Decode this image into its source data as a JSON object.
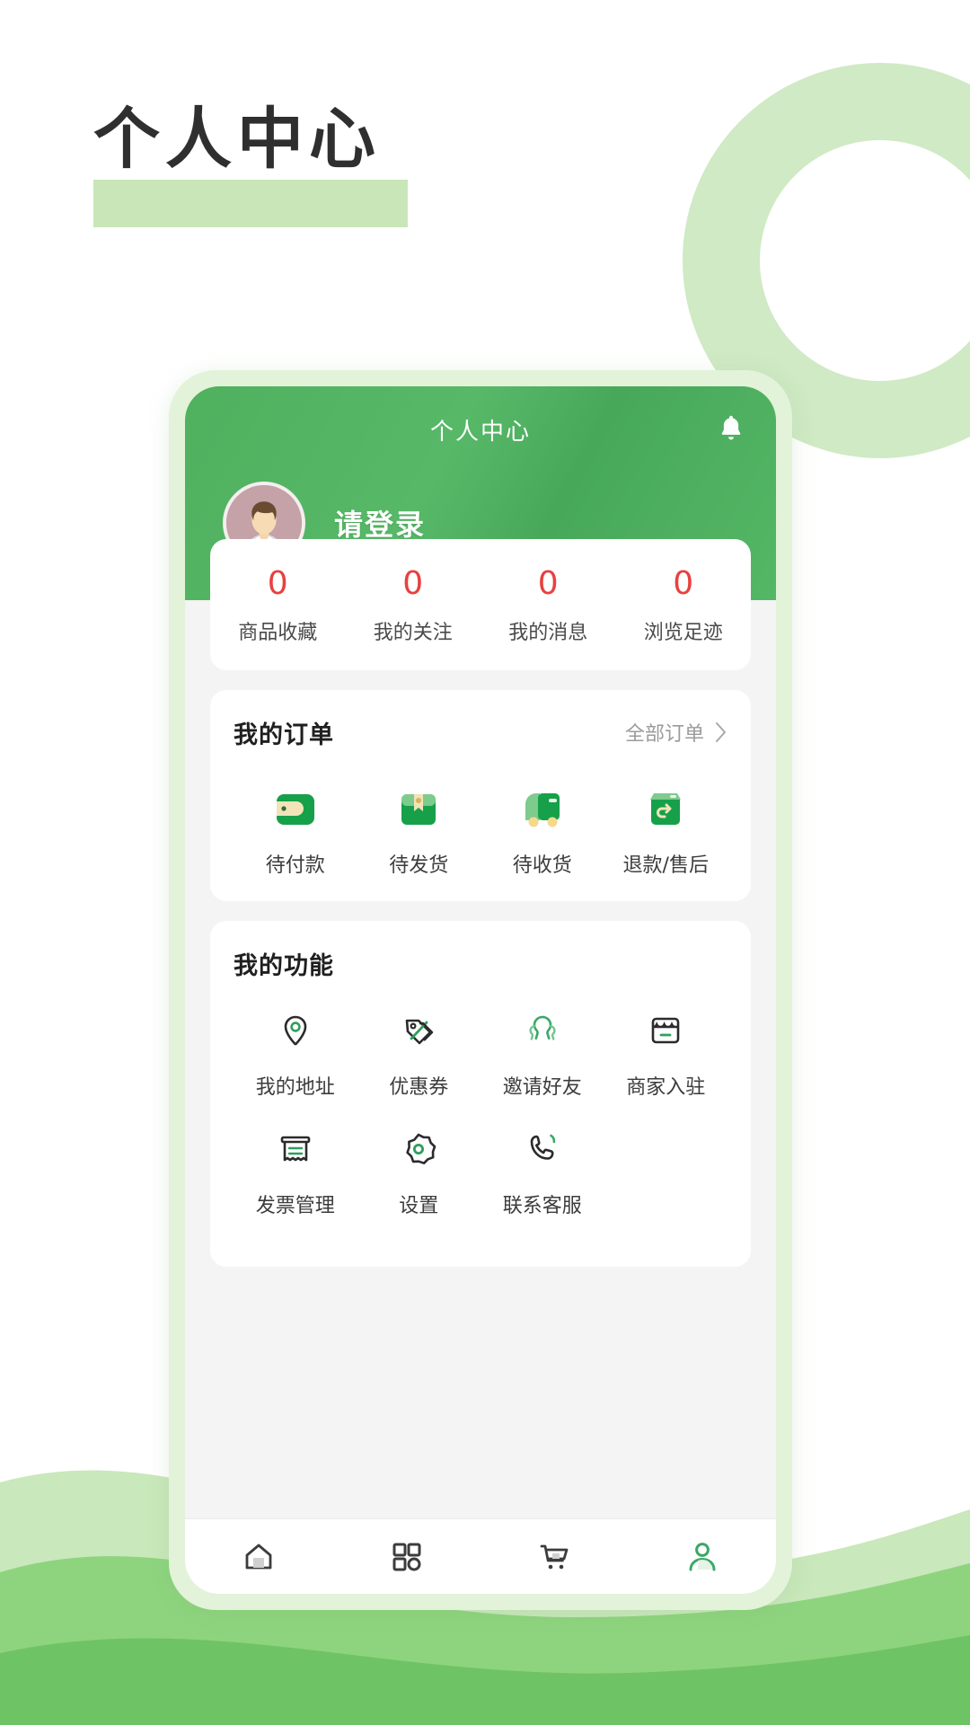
{
  "page": {
    "heading": "个人中心",
    "highlight_color": "#c8e6b8",
    "accent_green": "#4fb15e",
    "count_red": "#e8403e"
  },
  "app": {
    "header": {
      "title": "个人中心",
      "bell_icon": "bell-icon"
    },
    "user": {
      "login_prompt": "请登录",
      "avatar_icon": "avatar-person"
    },
    "stats": [
      {
        "value": "0",
        "label": "商品收藏"
      },
      {
        "value": "0",
        "label": "我的关注"
      },
      {
        "value": "0",
        "label": "我的消息"
      },
      {
        "value": "0",
        "label": "浏览足迹"
      }
    ],
    "orders": {
      "title": "我的订单",
      "more_label": "全部订单",
      "more_icon": "chevron-right-icon",
      "items": [
        {
          "label": "待付款",
          "icon": "wallet-icon"
        },
        {
          "label": "待发货",
          "icon": "package-icon"
        },
        {
          "label": "待收货",
          "icon": "truck-icon"
        },
        {
          "label": "退款/售后",
          "icon": "return-box-icon"
        }
      ]
    },
    "functions": {
      "title": "我的功能",
      "items": [
        {
          "label": "我的地址",
          "icon": "location-pin-icon"
        },
        {
          "label": "优惠券",
          "icon": "coupon-tag-icon"
        },
        {
          "label": "邀请好友",
          "icon": "invite-friends-icon"
        },
        {
          "label": "商家入驻",
          "icon": "store-icon"
        },
        {
          "label": "发票管理",
          "icon": "invoice-icon"
        },
        {
          "label": "设置",
          "icon": "gear-icon"
        },
        {
          "label": "联系客服",
          "icon": "phone-call-icon"
        }
      ]
    },
    "tabbar": [
      {
        "icon": "home-icon",
        "active": false
      },
      {
        "icon": "category-icon",
        "active": false
      },
      {
        "icon": "cart-icon",
        "active": false
      },
      {
        "icon": "profile-icon",
        "active": true
      }
    ]
  }
}
